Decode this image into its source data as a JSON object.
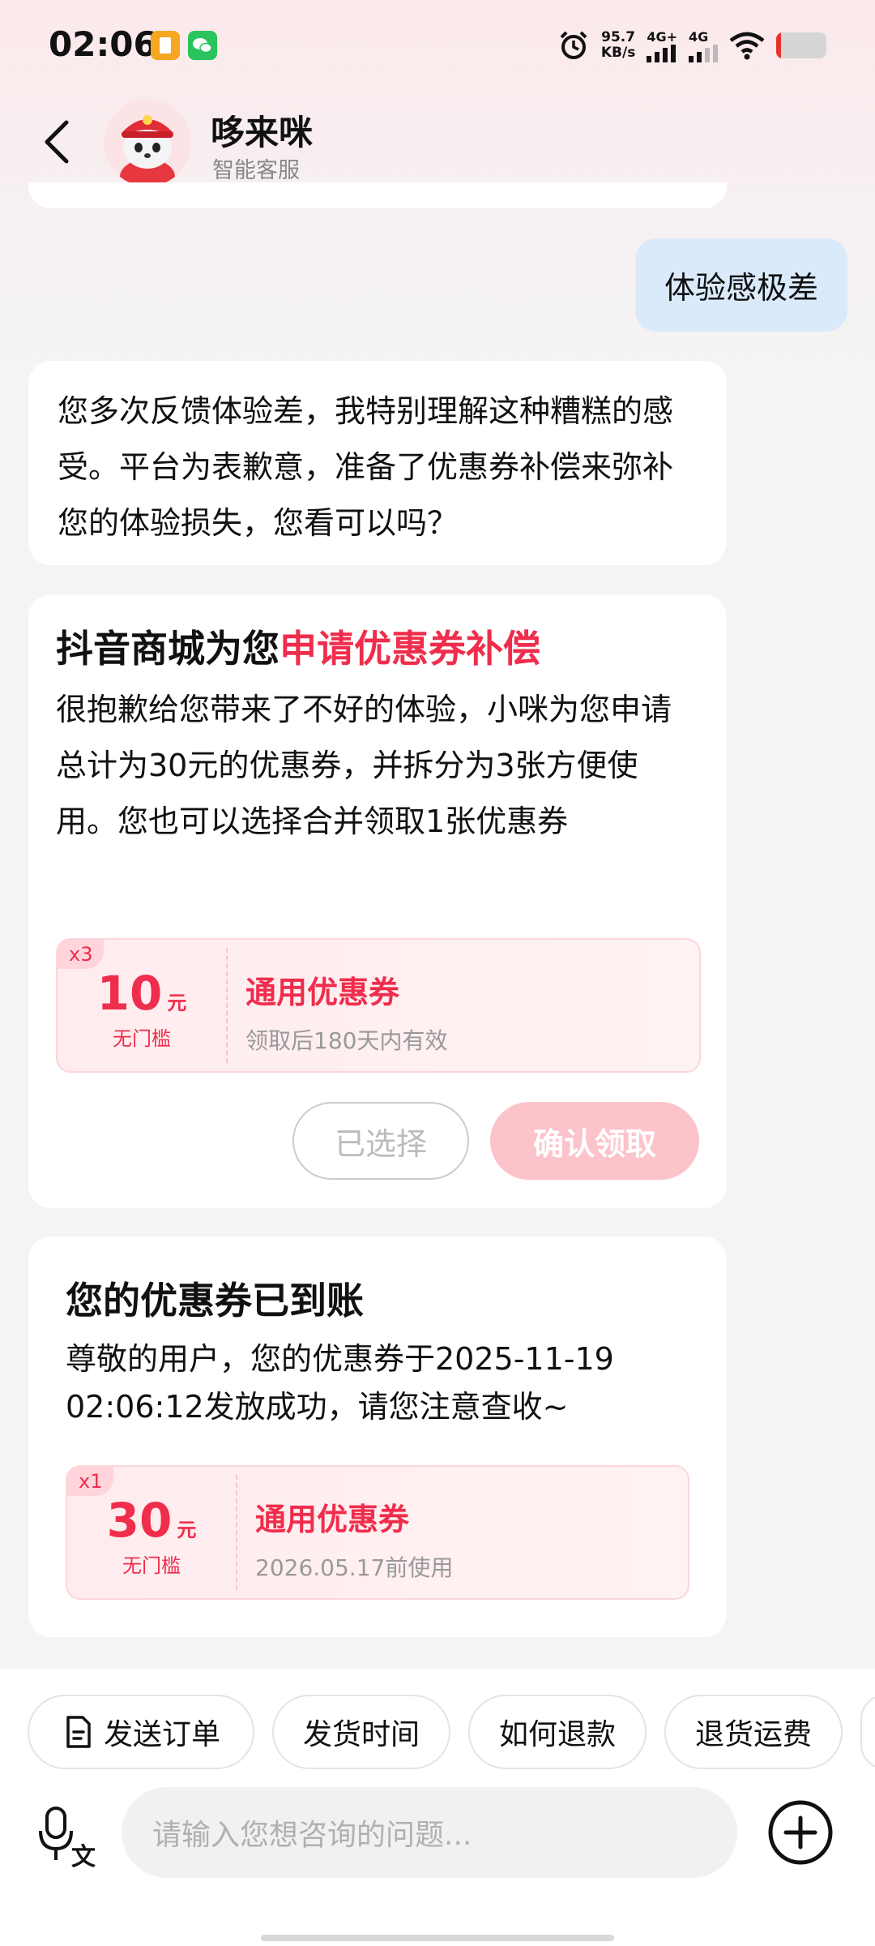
{
  "status_bar": {
    "time": "02:06",
    "net_speed_value": "95.7",
    "net_speed_unit": "KB/s",
    "signal1": "4G+",
    "signal2": "4G",
    "battery_level": 0.1
  },
  "header": {
    "title": "哆来咪",
    "subtitle": "智能客服"
  },
  "chat": {
    "user_message": "体验感极差",
    "bot_reply": "您多次反馈体验差，我特别理解这种糟糕的感受。平台为表歉意，准备了优惠券补偿来弥补您的体验损失，您看可以吗？",
    "compensation_card": {
      "title_prefix": "抖音商城为您",
      "title_highlight": "申请优惠券补偿",
      "body": "很抱歉给您带来了不好的体验，小咪为您申请总计为30元的优惠券，并拆分为3张方便使用。您也可以选择合并领取1张优惠券",
      "coupon": {
        "multiplier": "x3",
        "amount": "10",
        "unit": "元",
        "condition": "无门槛",
        "name": "通用优惠券",
        "desc": "领取后180天内有效"
      },
      "selected_label": "已选择",
      "confirm_label": "确认领取"
    },
    "arrival_card": {
      "title": "您的优惠券已到账",
      "body": "尊敬的用户，您的优惠券于2025-11-19 02:06:12发放成功，请您注意查收~",
      "coupon": {
        "multiplier": "x1",
        "amount": "30",
        "unit": "元",
        "condition": "无门槛",
        "name": "通用优惠券",
        "desc": "2026.05.17前使用"
      }
    }
  },
  "quick_replies": [
    "发送订单",
    "发货时间",
    "如何退款",
    "退货运费"
  ],
  "input": {
    "placeholder": "请输入您想咨询的问题..."
  },
  "colors": {
    "accent": "#ef2d4c",
    "user_bubble": "#dbeafb"
  }
}
